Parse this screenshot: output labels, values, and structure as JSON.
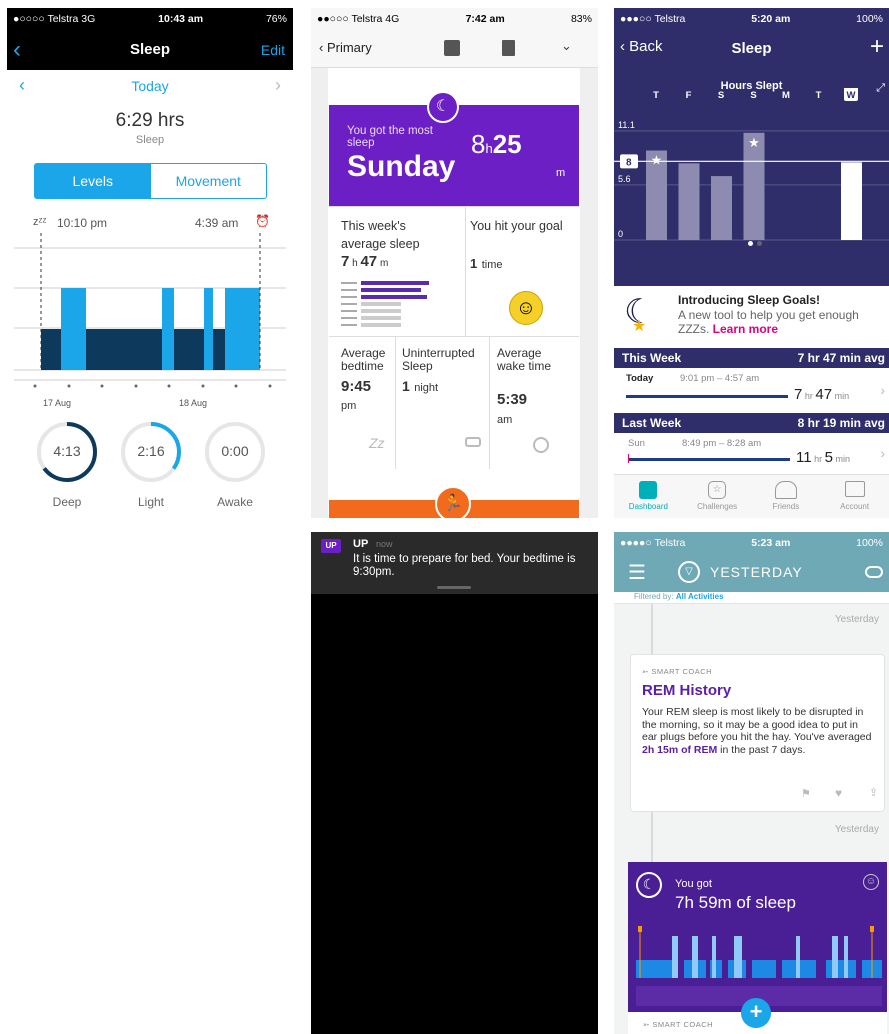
{
  "p1": {
    "status": {
      "left": "●○○○○ Telstra  3G",
      "time": "10:43 am",
      "right": "76%"
    },
    "nav": {
      "title": "Sleep",
      "edit": "Edit"
    },
    "date": "Today",
    "duration": "6:29 hrs",
    "duration_label": "Sleep",
    "tabs": [
      "Levels",
      "Movement"
    ],
    "start_marker": "zᶻᶻ",
    "start_time": "10:10 pm",
    "end_time": "4:39 am",
    "dates": [
      "17 Aug",
      "18 Aug"
    ],
    "stats": [
      {
        "value": "4:13",
        "label": "Deep",
        "pct": 0.65,
        "color": "#0d3a5c"
      },
      {
        "value": "2:16",
        "label": "Light",
        "pct": 0.35,
        "color": "#1aa6e8"
      },
      {
        "value": "0:00",
        "label": "Awake",
        "pct": 0,
        "color": "#9ecdf0"
      }
    ]
  },
  "p2": {
    "status": {
      "left": "●●○○○ Telstra  4G",
      "time": "7:42 am",
      "right": "83%"
    },
    "nav": {
      "back": "Primary"
    },
    "banner": {
      "line": "You got the most sleep",
      "day": "Sunday",
      "hours": "8",
      "h": "h",
      "minutes": "25",
      "m": "m"
    },
    "avg": {
      "label": "This week's average sleep",
      "h": "7",
      "hu": "h",
      "m": "47",
      "mu": "m"
    },
    "goal": {
      "label": "You hit your goal",
      "count": "1",
      "unit": "time"
    },
    "bottom": [
      {
        "label": "Average bedtime",
        "value": "9:45",
        "unit": "pm"
      },
      {
        "label": "Uninterrupted Sleep",
        "value": "1",
        "unit": "night"
      },
      {
        "label": "Average wake time",
        "value": "5:39",
        "unit": "am"
      }
    ],
    "zz": "Zz"
  },
  "p3": {
    "status": {
      "left": "●●●○○ Telstra",
      "time": "5:20 am",
      "right": "100%"
    },
    "nav": {
      "back": "Back",
      "title": "Sleep",
      "add": "+"
    },
    "chart_title": "Hours Slept",
    "chart_data": {
      "type": "bar",
      "categories": [
        "T",
        "F",
        "S",
        "S",
        "M",
        "T",
        "W"
      ],
      "values": [
        9.1,
        7.8,
        6.5,
        10.9,
        null,
        null,
        7.9
      ],
      "ylim": [
        0,
        12
      ],
      "yticks": [
        0,
        5.6,
        11.1
      ],
      "goal": 8,
      "goal_label": "8"
    },
    "ytick_labels": [
      "11.1",
      "5.6",
      "0"
    ],
    "promo": {
      "title": "Introducing Sleep Goals!",
      "text": "A new tool to help you get enough ZZZs.",
      "link": "Learn more"
    },
    "this_week": {
      "label": "This Week",
      "avg": "7 hr 47 min avg",
      "day": "Today",
      "range": "9:01 pm – 4:57 am",
      "h": "7",
      "hu": "hr",
      "m": "47",
      "mu": "min"
    },
    "last_week": {
      "label": "Last Week",
      "avg": "8 hr 19 min avg",
      "day": "Sun",
      "range": "8:49 pm – 8:28 am",
      "h": "11",
      "hu": "hr",
      "m": "5",
      "mu": "min"
    },
    "tabbar": [
      "Dashboard",
      "Challenges",
      "Friends",
      "Account"
    ]
  },
  "p4": {
    "app": "UP",
    "badge": "UP",
    "when": "now",
    "text": "It is time to prepare for bed. Your bedtime is 9:30pm."
  },
  "p5": {
    "status": {
      "left": "●●●●○ Telstra",
      "time": "5:23 am",
      "right": "100%"
    },
    "nav": {
      "title": "YESTERDAY"
    },
    "filter": {
      "label": "Filtered by:",
      "value": "All Activities"
    },
    "yesterday": "Yesterday",
    "coach": "SMART COACH",
    "card": {
      "title": "REM History",
      "text1": "Your REM sleep is most likely to be disrupted in the morning, so it may be a good idea to put in ear plugs before you hit the hay. You've averaged ",
      "bold": "2h 15m of REM",
      "text2": " in the past 7 days."
    },
    "sleep": {
      "line": "You got",
      "value": "7h 59m of sleep"
    },
    "fab": "+"
  }
}
